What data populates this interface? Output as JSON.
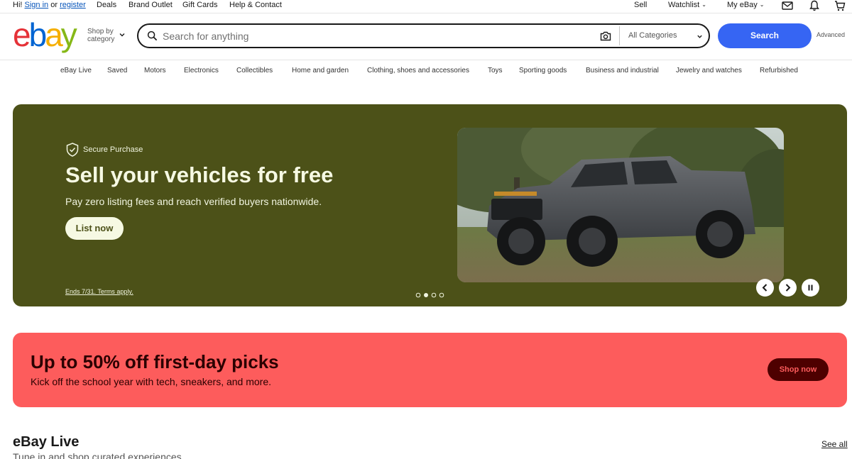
{
  "topbar": {
    "greeting_prefix": "Hi!",
    "sign_in": "Sign in",
    "or": "or",
    "register": "register",
    "links": [
      "Deals",
      "Brand Outlet",
      "Gift Cards",
      "Help & Contact"
    ],
    "sell": "Sell",
    "watchlist": "Watchlist",
    "my_ebay": "My eBay",
    "icons": [
      "mail-icon",
      "bell-icon",
      "cart-icon"
    ]
  },
  "header": {
    "logo_letters": [
      "e",
      "b",
      "a",
      "y"
    ],
    "shop_by_line1": "Shop by",
    "shop_by_line2": "category",
    "search_placeholder": "Search for anything",
    "category_select": "All Categories",
    "search_button": "Search",
    "advanced": "Advanced"
  },
  "category_nav": [
    "eBay Live",
    "Saved",
    "Motors",
    "Electronics",
    "Collectibles",
    "Home and garden",
    "Clothing, shoes and accessories",
    "Toys",
    "Sporting goods",
    "Business and industrial",
    "Jewelry and watches",
    "Refurbished"
  ],
  "hero": {
    "badge": "Secure Purchase",
    "title": "Sell your vehicles for free",
    "subtitle": "Pay zero listing fees and reach verified buyers nationwide.",
    "cta": "List now",
    "terms": "Ends 7/31. Terms apply.",
    "slide_count": 4,
    "active_slide": 2,
    "colors": {
      "background": "#4c5118",
      "text": "#f6f9e3"
    }
  },
  "promo": {
    "title": "Up to 50% off first-day picks",
    "subtitle": "Kick off the school year with tech, sneakers, and more.",
    "cta": "Shop now",
    "colors": {
      "background": "#fd5c5c",
      "button": "#4e0000"
    }
  },
  "live": {
    "title": "eBay Live",
    "subtitle": "Tune in and shop curated experiences",
    "see_all": "See all"
  }
}
